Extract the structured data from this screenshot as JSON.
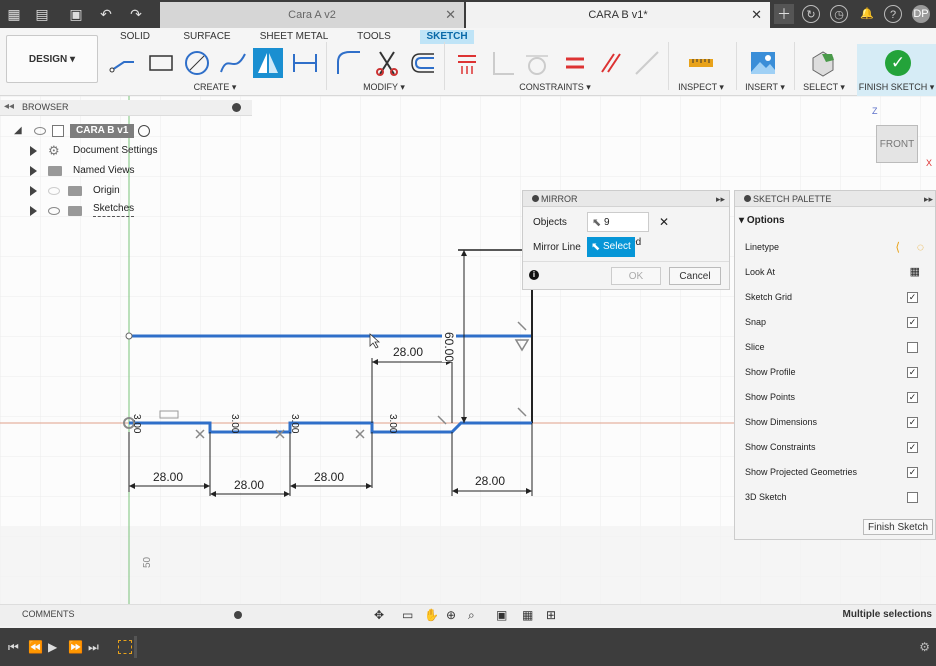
{
  "titlebar": {
    "tab1": "Cara A v2",
    "tab2": "CARA B v1*",
    "user_initials": "DP"
  },
  "ribbon": {
    "workspace": "DESIGN ▾",
    "tabs": [
      "SOLID",
      "SURFACE",
      "SHEET METAL",
      "TOOLS",
      "SKETCH"
    ],
    "groups": {
      "create": "CREATE ▾",
      "modify": "MODIFY ▾",
      "constraints": "CONSTRAINTS ▾",
      "inspect": "INSPECT ▾",
      "insert": "INSERT ▾",
      "select": "SELECT ▾",
      "finish": "FINISH SKETCH ▾"
    }
  },
  "browser": {
    "title": "BROWSER",
    "root": "CARA B v1",
    "items": [
      "Document Settings",
      "Named Views",
      "Origin",
      "Sketches"
    ]
  },
  "mirror": {
    "title": "MIRROR",
    "objects_label": "Objects",
    "objects_value": "9 selected",
    "mirror_line_label": "Mirror Line",
    "select_button": "Select",
    "ok": "OK",
    "cancel": "Cancel"
  },
  "palette": {
    "title": "SKETCH PALETTE",
    "section": "Options",
    "rows": [
      {
        "label": "Linetype",
        "type": "icons"
      },
      {
        "label": "Look At",
        "type": "icon"
      },
      {
        "label": "Sketch Grid",
        "checked": true
      },
      {
        "label": "Snap",
        "checked": true
      },
      {
        "label": "Slice",
        "checked": false
      },
      {
        "label": "Show Profile",
        "checked": true
      },
      {
        "label": "Show Points",
        "checked": true
      },
      {
        "label": "Show Dimensions",
        "checked": true
      },
      {
        "label": "Show Constraints",
        "checked": true
      },
      {
        "label": "Show Projected Geometries",
        "checked": true
      },
      {
        "label": "3D Sketch",
        "checked": false
      }
    ],
    "finish_button": "Finish Sketch"
  },
  "viewcube": {
    "face": "FRONT",
    "axis_z": "Z",
    "axis_x": "X"
  },
  "dimensions": {
    "d1": "28.00",
    "d2": "28.00",
    "d3": "28.00",
    "d4": "28.00",
    "d5": "28.00",
    "h1": "60.00",
    "s1": "3.00",
    "s2": "3.00",
    "s3": "3.00",
    "s4": "3.00",
    "ruler": "50"
  },
  "bottom": {
    "comments": "COMMENTS",
    "status": "Multiple selections"
  },
  "colors": {
    "sketch_line": "#2f6fc9",
    "axis_green": "#7ac37a",
    "axis_red": "#e0a08a",
    "accent": "#0696d7",
    "finish_green": "#24a33a"
  }
}
